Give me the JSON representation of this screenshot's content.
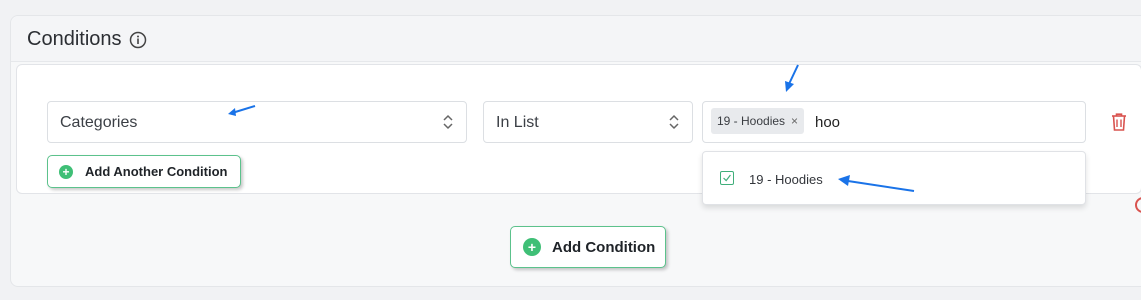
{
  "panel": {
    "title": "Conditions",
    "info_icon": "info-circle-icon"
  },
  "condition": {
    "field_select": {
      "value": "Categories"
    },
    "operator_select": {
      "value": "In List"
    },
    "value_select": {
      "tags": [
        {
          "label": "19 - Hoodies",
          "remove": "×"
        }
      ],
      "typed_text": "hoo"
    },
    "delete_icon": "trash-icon"
  },
  "dropdown": {
    "options": [
      {
        "label": "19 - Hoodies",
        "checked": true
      }
    ]
  },
  "buttons": {
    "add_another": "Add Another Condition",
    "add_condition": "Add Condition"
  },
  "colors": {
    "accent_green": "#3fbf76",
    "arrow_blue": "#1a73e8",
    "danger_red": "#d9534f"
  }
}
